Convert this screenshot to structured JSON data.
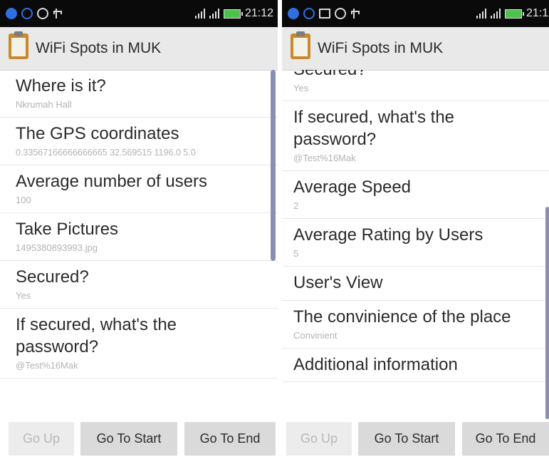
{
  "status": {
    "time": "21:12"
  },
  "app": {
    "title": "WiFi Spots in MUK",
    "icon": "clipboard-icon"
  },
  "left": {
    "items": [
      {
        "title": "Where is it?",
        "value": "Nkrumah Hall"
      },
      {
        "title": "The GPS coordinates",
        "value": "0.33567166666666665 32.569515 1196.0 5.0"
      },
      {
        "title": "Average number of users",
        "value": "100"
      },
      {
        "title": "Take Pictures",
        "value": "1495380893993.jpg"
      },
      {
        "title": "Secured?",
        "value": "Yes"
      },
      {
        "title": "If secured, what's the password?",
        "value": "@Test%16Mak"
      }
    ]
  },
  "right": {
    "items": [
      {
        "title": "Secured?",
        "value": "Yes"
      },
      {
        "title": "If secured, what's the password?",
        "value": "@Test%16Mak"
      },
      {
        "title": "Average Speed",
        "value": "2"
      },
      {
        "title": "Average Rating by Users",
        "value": "5"
      },
      {
        "title": "User's View",
        "value": ""
      },
      {
        "title": "The convinience of the place",
        "value": "Convinient"
      },
      {
        "title": "Additional information",
        "value": ""
      }
    ]
  },
  "buttons": {
    "up": "Go Up",
    "start": "Go To Start",
    "end": "Go To End"
  }
}
